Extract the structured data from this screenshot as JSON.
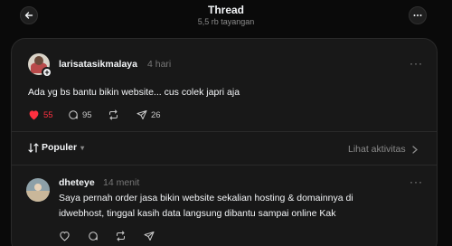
{
  "header": {
    "title": "Thread",
    "subtitle": "5,5 rb tayangan"
  },
  "post": {
    "username": "larisatasikmalaya",
    "time": "4 hari",
    "text": "Ada yg bs bantu bikin website... cus colek japri aja",
    "likes": "55",
    "comments": "95",
    "shares": "26",
    "liked": true
  },
  "sort": {
    "label": "Populer",
    "activity_label": "Lihat aktivitas"
  },
  "reply": {
    "username": "dheteye",
    "time": "14 menit",
    "text_line1": "Saya pernah order jasa bikin website sekalian hosting & domainnya di",
    "text_line2": "idwebhost, tinggal kasih data langsung dibantu sampai online Kak"
  },
  "colors": {
    "background": "#0a0a0a",
    "card": "#181818",
    "like": "#ff3040",
    "muted": "#8a8a8a"
  }
}
